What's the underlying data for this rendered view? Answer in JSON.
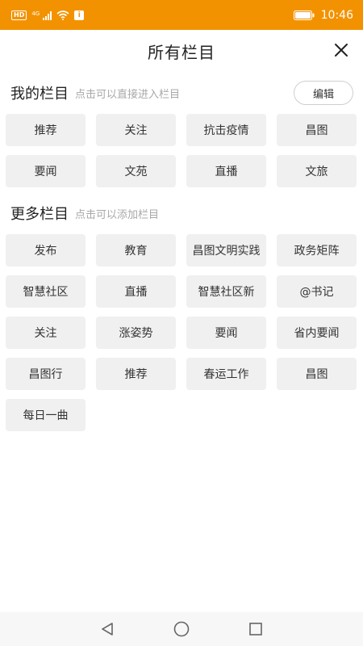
{
  "status_bar": {
    "hd_label": "HD",
    "network_label": "4G",
    "time": "10:46",
    "background_color": "#f39200",
    "icons": [
      "signal-icon",
      "wifi-icon",
      "notification-icon",
      "battery-icon"
    ]
  },
  "header": {
    "title": "所有栏目",
    "close_icon": "close-icon"
  },
  "my_section": {
    "title": "我的栏目",
    "hint": "点击可以直接进入栏目",
    "edit_label": "编辑",
    "items": [
      "推荐",
      "关注",
      "抗击疫情",
      "昌图",
      "要闻",
      "文苑",
      "直播",
      "文旅"
    ]
  },
  "more_section": {
    "title": "更多栏目",
    "hint": "点击可以添加栏目",
    "items": [
      "发布",
      "教育",
      "昌图文明实践",
      "政务矩阵",
      "智慧社区",
      "直播",
      "智慧社区新",
      "@书记",
      "关注",
      "涨姿势",
      "要闻",
      "省内要闻",
      "昌图行",
      "推荐",
      "春运工作",
      "昌图",
      "每日一曲"
    ]
  },
  "nav_bar": {
    "icons": [
      "back-triangle-icon",
      "home-circle-icon",
      "recents-square-icon"
    ]
  }
}
